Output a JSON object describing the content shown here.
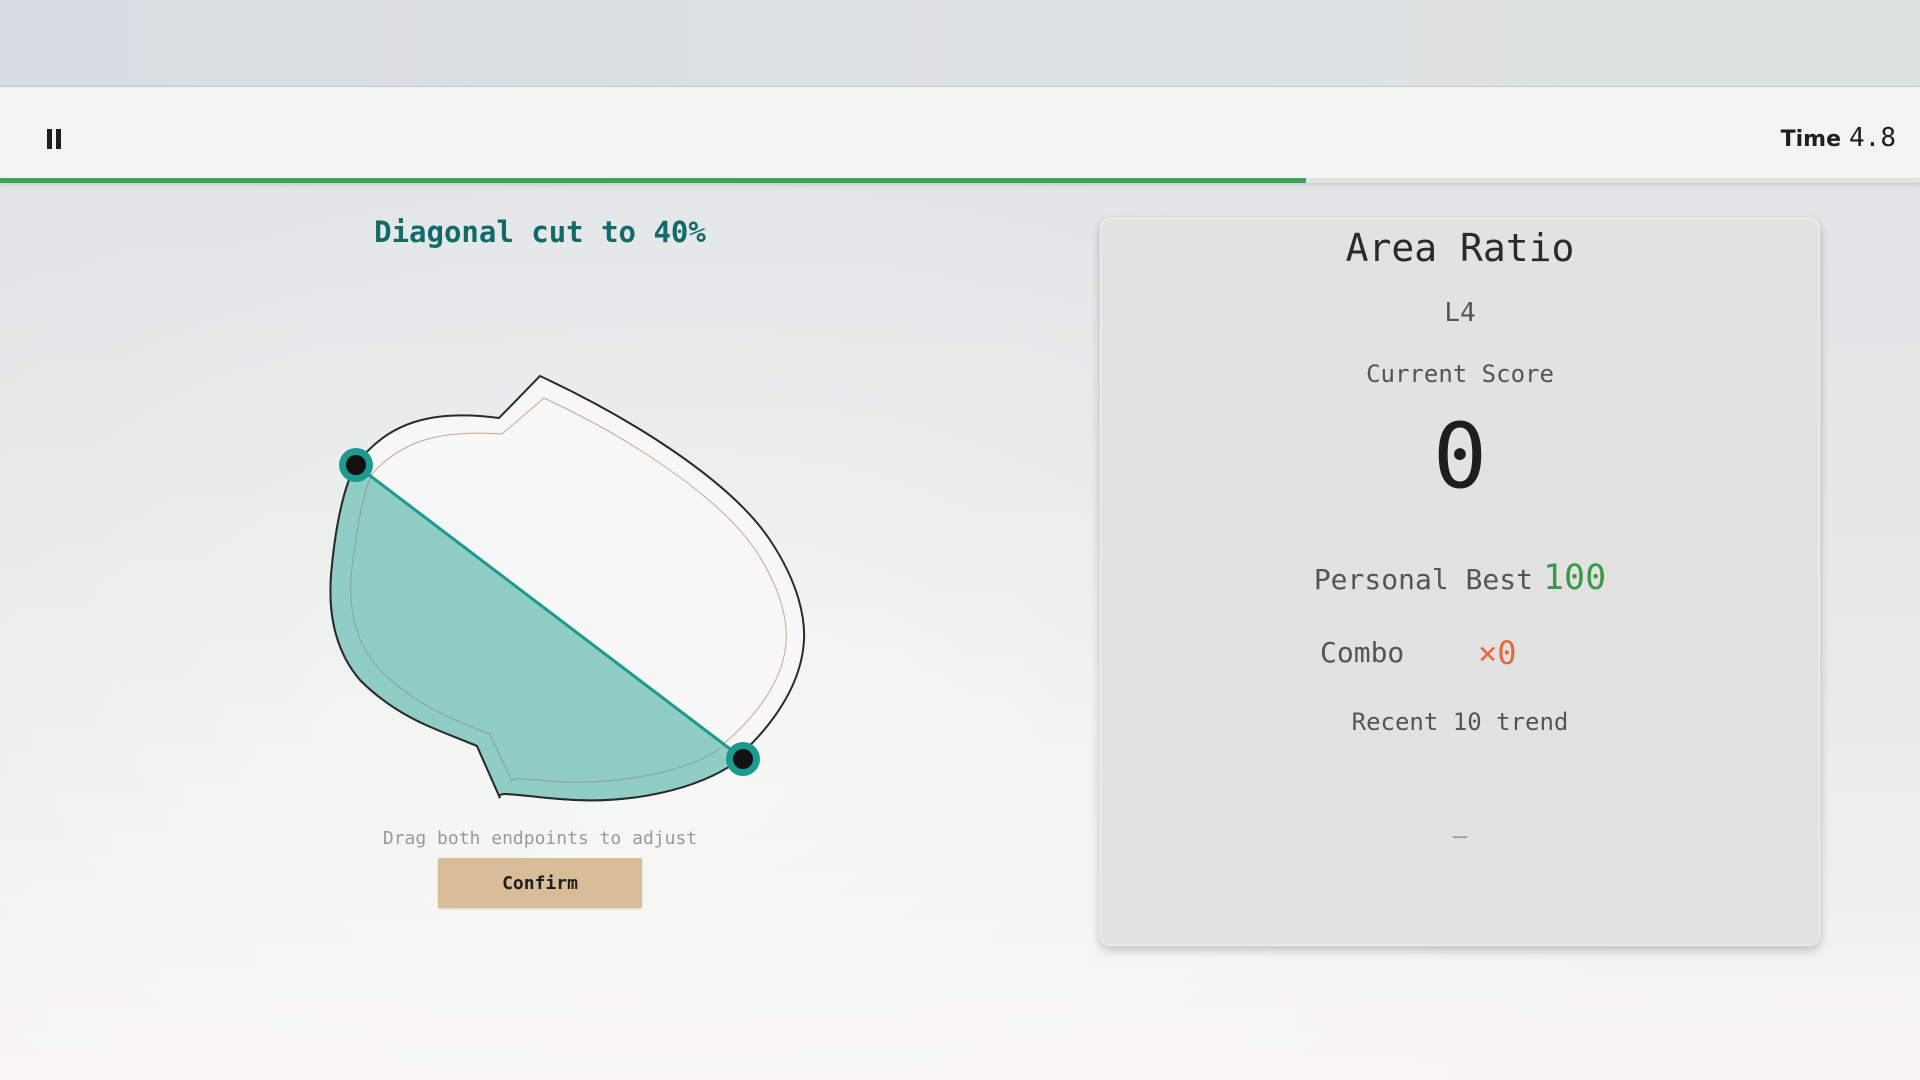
{
  "hud": {
    "pause_icon": "pause-icon",
    "time_label": "Time",
    "time_value": "4.8",
    "time_progress": 0.68
  },
  "task": {
    "prompt": "Diagonal cut to 40%",
    "hint": "Drag both endpoints to adjust",
    "confirm_label": "Confirm"
  },
  "colors": {
    "accent_teal": "#1c9a90",
    "cut_fill": "#8fcdc5",
    "progress_green": "#3fa257",
    "best_green": "#3b9a4a",
    "combo_orange": "#e6683f",
    "confirm_tan": "#d8bd98"
  },
  "panel": {
    "title": "Area Ratio",
    "level": "L4",
    "score_label": "Current Score",
    "score": "0",
    "best_label": "Personal Best",
    "best_value": "100",
    "combo_label": "Combo",
    "combo_value": "×0",
    "trend_label": "Recent 10 trend",
    "trend_empty": "–"
  }
}
